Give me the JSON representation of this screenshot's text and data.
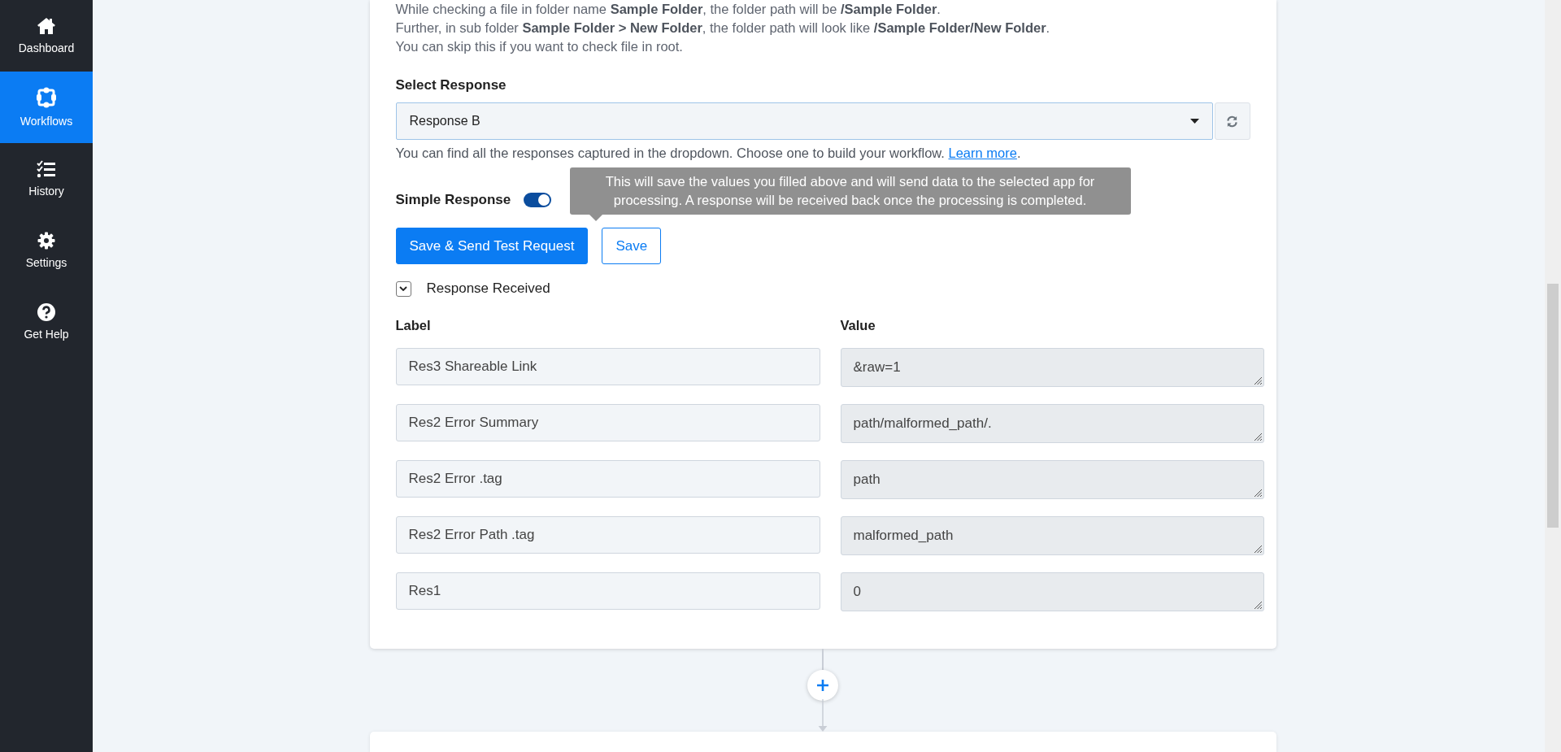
{
  "sidebar": {
    "items": [
      {
        "label": "Dashboard",
        "selected": false
      },
      {
        "label": "Workflows",
        "selected": true
      },
      {
        "label": "History",
        "selected": false
      },
      {
        "label": "Settings",
        "selected": false
      },
      {
        "label": "Get Help",
        "selected": false
      }
    ]
  },
  "folder_help": [
    "While checking a file in folder name **Sample Folder**, the folder path will be **/Sample Folder**.",
    "Further, in sub folder **Sample Folder > New Folder**, the folder path will look like **/Sample Folder/New Folder**.",
    "You can skip this if you want to check file in root."
  ],
  "select_response": {
    "label": "Select Response",
    "value": "Response B",
    "help": "You can find all the responses captured in the dropdown. Choose one to build your workflow.",
    "link": "Learn more",
    "after_link": "."
  },
  "simple_response": {
    "label": "Simple Response",
    "on": true
  },
  "buttons": [
    {
      "label": "Save & Send Test Request",
      "kind": "primary"
    },
    {
      "label": "Save",
      "kind": "outline"
    }
  ],
  "tooltip": "This will save the values you filled above and will send data to the selected app for processing. A response will be received back once the processing is completed.",
  "response_received": {
    "label": "Response Received",
    "expanded": true
  },
  "table": {
    "columns": [
      "Label",
      "Value"
    ],
    "rows": [
      {
        "label": "Res3 Shareable Link",
        "value": "&raw=1"
      },
      {
        "label": "Res2 Error Summary",
        "value": "path/malformed_path/."
      },
      {
        "label": "Res2 Error .tag",
        "value": "path"
      },
      {
        "label": "Res2 Error Path .tag",
        "value": "malformed_path"
      },
      {
        "label": "Res1",
        "value": "0"
      }
    ]
  }
}
